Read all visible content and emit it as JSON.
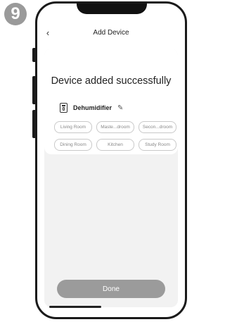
{
  "step_number": "9",
  "header": {
    "back_glyph": "‹",
    "title": "Add Device"
  },
  "main": {
    "success_message": "Device added successfully",
    "device": {
      "name": "Dehumidifier",
      "edit_icon": "pencil-icon",
      "type_icon": "dehumidifier-icon"
    },
    "rooms": [
      "Living Room",
      "Maste...droom",
      "Secon...droom",
      "Dining Room",
      "Kitchen",
      "Study Room"
    ]
  },
  "footer": {
    "done_label": "Done"
  },
  "colors": {
    "done_button": "#9b9b9b",
    "badge": "#9a9a9a",
    "frame": "#1a1a1a"
  }
}
